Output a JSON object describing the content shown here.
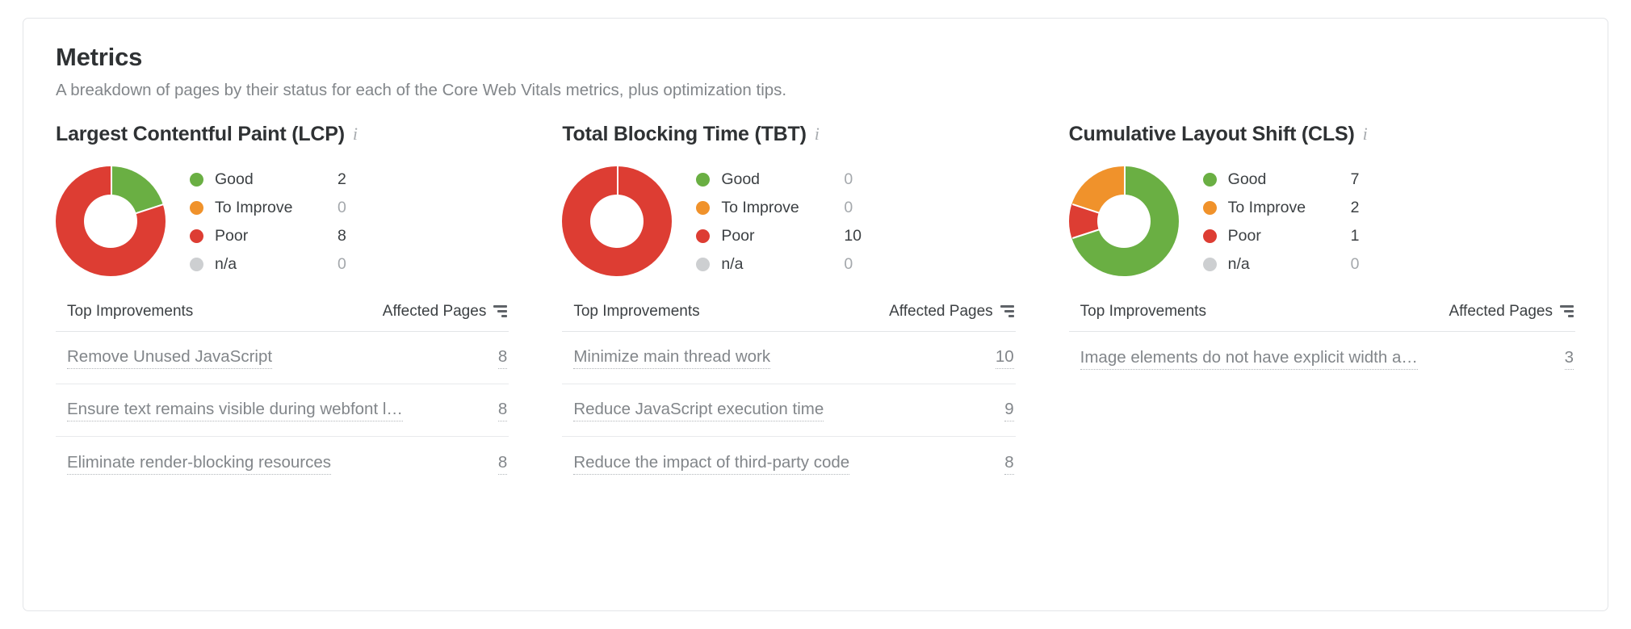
{
  "card": {
    "title": "Metrics",
    "subtitle": "A breakdown of pages by their status for each of the Core Web Vitals metrics, plus optimization tips."
  },
  "colors": {
    "good": "#6aaf43",
    "to_improve": "#f0922b",
    "poor": "#dd3d33",
    "na": "#cdcfd1",
    "text": "#3c4043",
    "muted": "#82868a",
    "border": "#e3e5e8"
  },
  "table_headers": {
    "improvements": "Top Improvements",
    "affected_pages": "Affected Pages",
    "sort_icon": "sort-descending-icon"
  },
  "info_icon": "info-italic-i-icon",
  "metrics": [
    {
      "id": "lcp",
      "name": "Largest Contentful Paint (LCP)",
      "legend": [
        {
          "label": "Good",
          "value": "2",
          "color_key": "good",
          "zero": false
        },
        {
          "label": "To Improve",
          "value": "0",
          "color_key": "to_improve",
          "zero": true
        },
        {
          "label": "Poor",
          "value": "8",
          "color_key": "poor",
          "zero": false
        },
        {
          "label": "n/a",
          "value": "0",
          "color_key": "na",
          "zero": true
        }
      ],
      "rows": [
        {
          "label": "Remove Unused JavaScript",
          "count": "8"
        },
        {
          "label": "Ensure text remains visible during webfont l…",
          "count": "8"
        },
        {
          "label": "Eliminate render-blocking resources",
          "count": "8"
        }
      ]
    },
    {
      "id": "tbt",
      "name": "Total Blocking Time (TBT)",
      "legend": [
        {
          "label": "Good",
          "value": "0",
          "color_key": "good",
          "zero": true
        },
        {
          "label": "To Improve",
          "value": "0",
          "color_key": "to_improve",
          "zero": true
        },
        {
          "label": "Poor",
          "value": "10",
          "color_key": "poor",
          "zero": false
        },
        {
          "label": "n/a",
          "value": "0",
          "color_key": "na",
          "zero": true
        }
      ],
      "rows": [
        {
          "label": "Minimize main thread work",
          "count": "10"
        },
        {
          "label": "Reduce JavaScript execution time",
          "count": "9"
        },
        {
          "label": "Reduce the impact of third-party code",
          "count": "8"
        }
      ]
    },
    {
      "id": "cls",
      "name": "Cumulative Layout Shift (CLS)",
      "legend": [
        {
          "label": "Good",
          "value": "7",
          "color_key": "good",
          "zero": false
        },
        {
          "label": "To Improve",
          "value": "2",
          "color_key": "to_improve",
          "zero": false
        },
        {
          "label": "Poor",
          "value": "1",
          "color_key": "poor",
          "zero": false
        },
        {
          "label": "n/a",
          "value": "0",
          "color_key": "na",
          "zero": true
        }
      ],
      "rows": [
        {
          "label": "Image elements do not have explicit width a…",
          "count": "3"
        }
      ]
    }
  ],
  "chart_data": [
    {
      "type": "pie",
      "title": "Largest Contentful Paint (LCP)",
      "subtype": "donut",
      "categories": [
        "Good",
        "To Improve",
        "Poor",
        "n/a"
      ],
      "values": [
        2,
        0,
        8,
        0
      ],
      "colors": [
        "#6aaf43",
        "#f0922b",
        "#dd3d33",
        "#cdcfd1"
      ],
      "total": 10,
      "legend_position": "right"
    },
    {
      "type": "pie",
      "title": "Total Blocking Time (TBT)",
      "subtype": "donut",
      "categories": [
        "Good",
        "To Improve",
        "Poor",
        "n/a"
      ],
      "values": [
        0,
        0,
        10,
        0
      ],
      "colors": [
        "#6aaf43",
        "#f0922b",
        "#dd3d33",
        "#cdcfd1"
      ],
      "total": 10,
      "legend_position": "right"
    },
    {
      "type": "pie",
      "title": "Cumulative Layout Shift (CLS)",
      "subtype": "donut",
      "categories": [
        "Good",
        "To Improve",
        "Poor",
        "n/a"
      ],
      "values": [
        7,
        2,
        1,
        0
      ],
      "colors": [
        "#6aaf43",
        "#f0922b",
        "#dd3d33",
        "#cdcfd1"
      ],
      "total": 10,
      "legend_position": "right"
    }
  ]
}
